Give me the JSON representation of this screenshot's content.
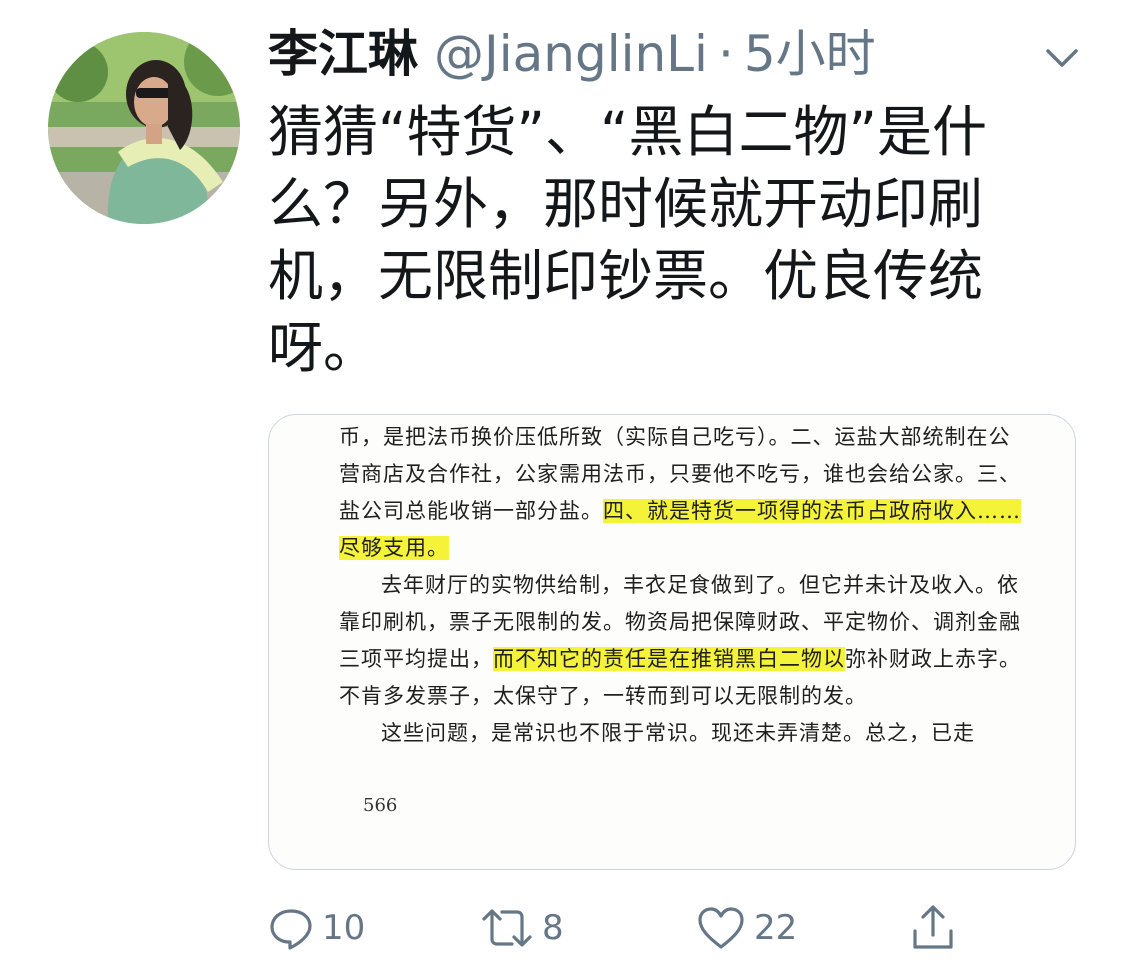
{
  "tweet": {
    "display_name": "李江琳",
    "handle": "@JianglinLi",
    "separator": "·",
    "timestamp": "5小时",
    "text": "猜猜“特货”、“黑白二物”是什么？另外，那时候就开动印刷机，无限制印钞票。优良传统呀。"
  },
  "media": {
    "page_number": "566",
    "highlight_color": "#f5f23a",
    "paragraphs": [
      {
        "indent": false,
        "before": "币，是把法币换价压低所致（实际自己吃亏）。二、运盐大部统制在公营商店及合作社，公家需用法币，只要他不吃亏，谁也会给公家。三、盐公司总能收销一部分盐。",
        "highlight": "四、就是特货一项得的法币占政府收入……尽够支用。",
        "after": ""
      },
      {
        "indent": true,
        "before": "去年财厅的实物供给制，丰衣足食做到了。但它并未计及收入。依靠印刷机，票子无限制的发。物资局把保障财政、平定物价、调剂金融三项平均提出，",
        "highlight": "而不知它的责任是在推销黑白二物以",
        "after": "弥补财政上赤字。不肯多发票子，太保守了，一转而到可以无限制的发。"
      },
      {
        "indent": true,
        "before": "这些问题，是常识也不限于常识。现还未弄清楚。总之，已走",
        "highlight": "",
        "after": ""
      }
    ]
  },
  "actions": {
    "reply": {
      "icon": "reply-icon",
      "count": "10"
    },
    "retweet": {
      "icon": "retweet-icon",
      "count": "8"
    },
    "like": {
      "icon": "heart-icon",
      "count": "22"
    },
    "share": {
      "icon": "share-icon"
    }
  },
  "colors": {
    "text_primary": "#14171a",
    "text_secondary": "#657786",
    "card_border": "#ccd6dd"
  }
}
